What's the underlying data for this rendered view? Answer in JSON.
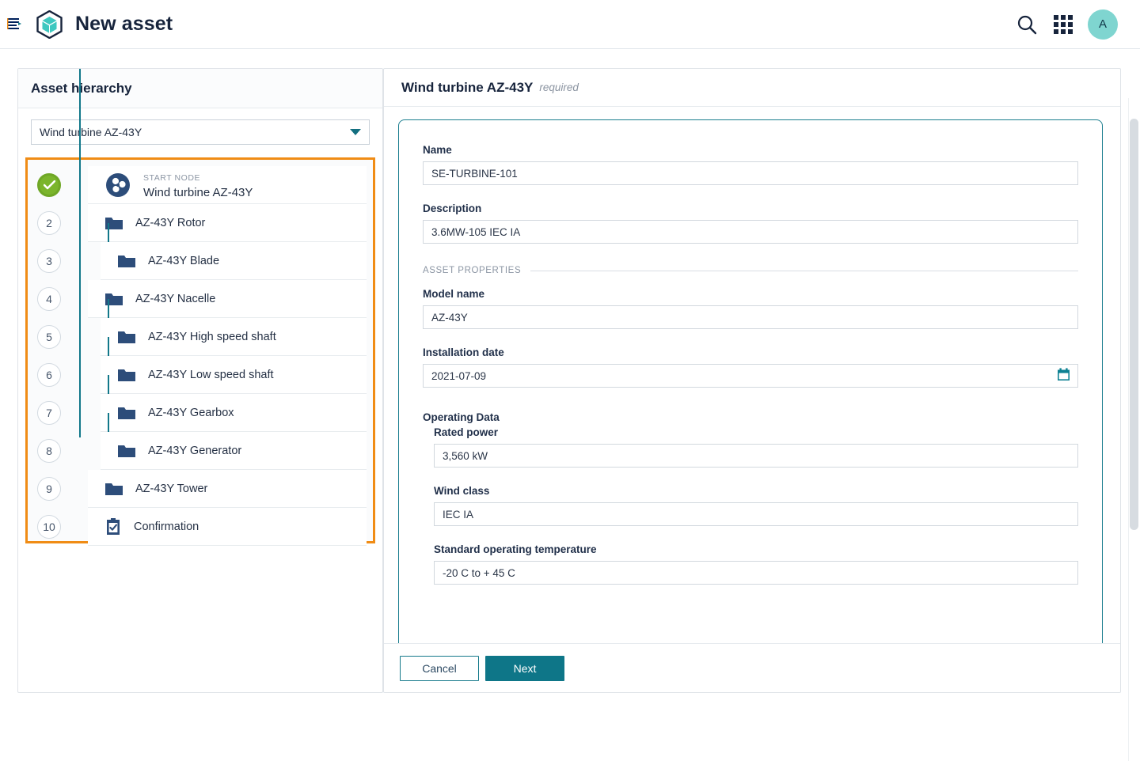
{
  "appbar": {
    "panel_toggle_icon": "collapse-panel-icon",
    "brand_icon": "cube-logo-icon",
    "title": "New asset",
    "search_icon": "search-icon",
    "apps_icon": "apps-grid-icon",
    "avatar_initial": "A"
  },
  "colors": {
    "accent_teal": "#0e7688",
    "brand_cyan": "#3ec8c0",
    "highlight_orange": "#f08c15",
    "success_green": "#7bb52c",
    "node_navy": "#2d4d7a",
    "text_dark": "#17243c",
    "text_muted": "#8b95a3"
  },
  "hierarchy": {
    "panel_title": "Asset hierarchy",
    "selector": {
      "value": "Wind turbine AZ-43Y",
      "placeholder": "Select asset",
      "caret_icon": "chevron-down-icon"
    },
    "nodes": [
      {
        "step": "1",
        "step_display": "",
        "state": "done",
        "level": 0,
        "icon": "wind-turbine-node-icon",
        "kicker": "START NODE",
        "label": "Wind turbine AZ-43Y"
      },
      {
        "step": "2",
        "step_display": "2",
        "state": "pending",
        "level": 1,
        "icon": "folder-icon",
        "kicker": "",
        "label": "AZ-43Y Rotor"
      },
      {
        "step": "3",
        "step_display": "3",
        "state": "pending",
        "level": 2,
        "icon": "folder-icon",
        "kicker": "",
        "label": "AZ-43Y Blade"
      },
      {
        "step": "4",
        "step_display": "4",
        "state": "pending",
        "level": 1,
        "icon": "folder-icon",
        "kicker": "",
        "label": "AZ-43Y Nacelle"
      },
      {
        "step": "5",
        "step_display": "5",
        "state": "pending",
        "level": 2,
        "icon": "folder-icon",
        "kicker": "",
        "label": "AZ-43Y High speed shaft"
      },
      {
        "step": "6",
        "step_display": "6",
        "state": "pending",
        "level": 2,
        "icon": "folder-icon",
        "kicker": "",
        "label": "AZ-43Y Low speed shaft"
      },
      {
        "step": "7",
        "step_display": "7",
        "state": "pending",
        "level": 2,
        "icon": "folder-icon",
        "kicker": "",
        "label": "AZ-43Y Gearbox"
      },
      {
        "step": "8",
        "step_display": "8",
        "state": "pending",
        "level": 2,
        "icon": "folder-icon",
        "kicker": "",
        "label": "AZ-43Y Generator"
      },
      {
        "step": "9",
        "step_display": "9",
        "state": "pending",
        "level": 1,
        "icon": "folder-icon",
        "kicker": "",
        "label": "AZ-43Y Tower"
      },
      {
        "step": "10",
        "step_display": "10",
        "state": "pending",
        "level": 1,
        "icon": "clipboard-check-icon",
        "kicker": "",
        "label": "Confirmation"
      }
    ]
  },
  "form": {
    "header_title": "Wind turbine AZ-43Y",
    "header_required": "required",
    "fields": {
      "name": {
        "label": "Name",
        "value": "SE-TURBINE-101",
        "placeholder": "Enter name"
      },
      "description": {
        "label": "Description",
        "value": "3.6MW-105 IEC IA",
        "placeholder": "Enter description"
      }
    },
    "asset_properties": {
      "group_label": "ASSET PROPERTIES",
      "model_name": {
        "label": "Model name",
        "value": "AZ-43Y",
        "placeholder": "Enter model name"
      },
      "installation_date": {
        "label": "Installation date",
        "value": "2021-07-09",
        "placeholder": "YYYY-MM-DD",
        "icon": "calendar-icon"
      }
    },
    "operating_data": {
      "group_label": "Operating Data",
      "rated_power": {
        "label": "Rated power",
        "value": "3,560 kW",
        "placeholder": "Enter rated power"
      },
      "wind_class": {
        "label": "Wind class",
        "value": "IEC IA",
        "placeholder": "Enter wind class"
      },
      "standard_operating_temperature": {
        "label": "Standard operating temperature",
        "value": "-20 C to + 45 C",
        "placeholder": "Enter temperature range"
      }
    },
    "footer": {
      "cancel_label": "Cancel",
      "next_label": "Next"
    }
  }
}
